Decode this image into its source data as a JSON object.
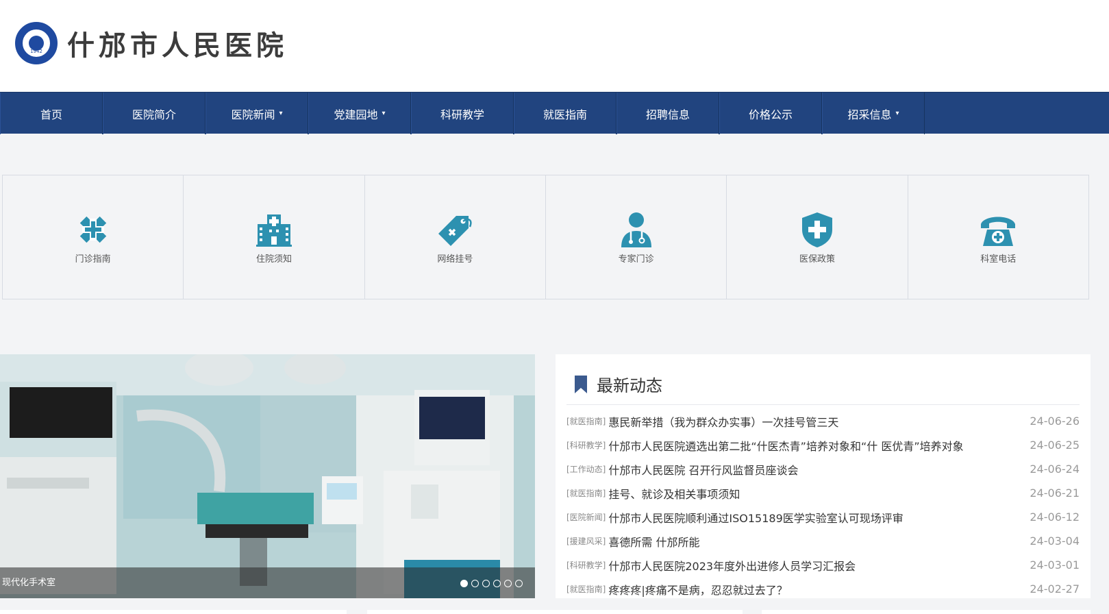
{
  "header": {
    "logo_text": "什邡市人民医院",
    "seal_year": "1942"
  },
  "nav": {
    "items": [
      {
        "label": "首页",
        "has_dropdown": false
      },
      {
        "label": "医院简介",
        "has_dropdown": false
      },
      {
        "label": "医院新闻",
        "has_dropdown": true
      },
      {
        "label": "党建园地",
        "has_dropdown": true
      },
      {
        "label": "科研教学",
        "has_dropdown": false
      },
      {
        "label": "就医指南",
        "has_dropdown": false
      },
      {
        "label": "招聘信息",
        "has_dropdown": false
      },
      {
        "label": "价格公示",
        "has_dropdown": false
      },
      {
        "label": "招采信息",
        "has_dropdown": true
      }
    ],
    "caret": "▾"
  },
  "quick_links": [
    {
      "label": "门诊指南",
      "icon": "medical-cross-icon"
    },
    {
      "label": "住院须知",
      "icon": "hospital-building-icon"
    },
    {
      "label": "网络挂号",
      "icon": "tag-icon"
    },
    {
      "label": "专家门诊",
      "icon": "doctor-icon"
    },
    {
      "label": "医保政策",
      "icon": "shield-plus-icon"
    },
    {
      "label": "科室电话",
      "icon": "telephone-icon"
    }
  ],
  "slider": {
    "caption": "现代化手术室",
    "slide_count": 6,
    "active_index": 0
  },
  "news": {
    "title": "最新动态",
    "items": [
      {
        "category": "[就医指南]",
        "title": "惠民新举措（我为群众办实事）一次挂号管三天",
        "date": "24-06-26"
      },
      {
        "category": "[科研教学]",
        "title": "什邡市人民医院遴选出第二批“什医杰青”培养对象和“什 医优青”培养对象",
        "date": "24-06-25"
      },
      {
        "category": "[工作动态]",
        "title": "什邡市人民医院 召开行风监督员座谈会",
        "date": "24-06-24"
      },
      {
        "category": "[就医指南]",
        "title": "挂号、就诊及相关事项须知",
        "date": "24-06-21"
      },
      {
        "category": "[医院新闻]",
        "title": "什邡市人民医院顺利通过ISO15189医学实验室认可现场评审",
        "date": "24-06-12"
      },
      {
        "category": "[援建风采]",
        "title": "喜德所需 什邡所能",
        "date": "24-03-04"
      },
      {
        "category": "[科研教学]",
        "title": "什邡市人民医院2023年度外出进修人员学习汇报会",
        "date": "24-03-01"
      },
      {
        "category": "[就医指南]",
        "title": "疼疼疼|疼痛不是病，忍忍就过去了？",
        "date": "24-02-27"
      }
    ]
  },
  "colors": {
    "nav_bg": "#21447f",
    "icon_teal": "#2d91b0",
    "brand_blue": "#1f4aa0"
  }
}
